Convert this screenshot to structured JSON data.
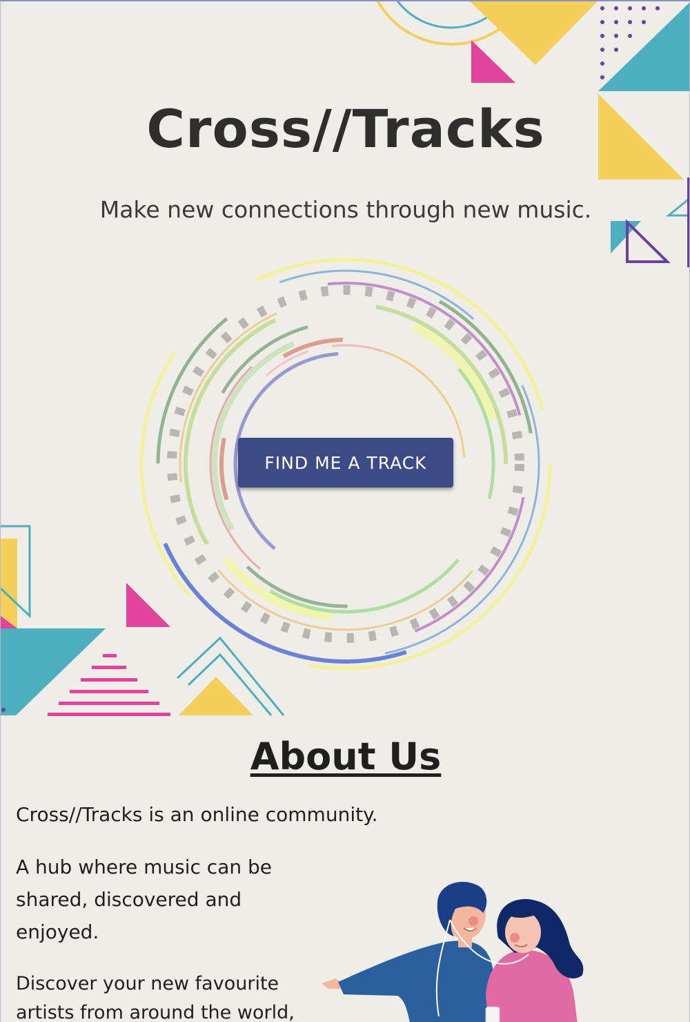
{
  "hero": {
    "title": "Cross//Tracks",
    "tagline": "Make new connections through new music.",
    "cta_label": "FIND ME A TRACK"
  },
  "about": {
    "heading": "About Us",
    "paragraphs": [
      "Cross//Tracks is an online community.",
      "A hub where music can be shared, discovered and enjoyed.",
      "Discover your new favourite artists from around the world,"
    ]
  },
  "colors": {
    "background": "#efede8",
    "button": "#3c4a86",
    "teal": "#4daebf",
    "yellow": "#f4cf5a",
    "pink": "#e2439b",
    "purple": "#6b3fa0"
  },
  "icons": {
    "rings": "music-rings-graphic",
    "couple": "couple-listening-illustration"
  }
}
